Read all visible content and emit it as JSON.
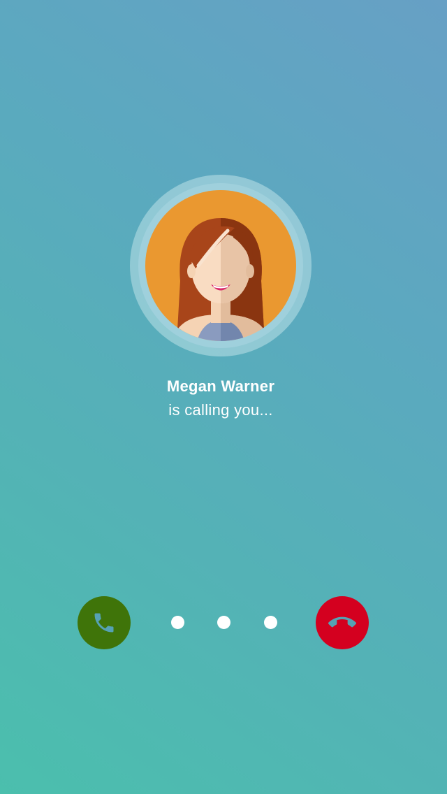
{
  "caller": {
    "name": "Megan Warner",
    "status": "is calling you..."
  },
  "actions": {
    "accept": {
      "icon": "phone-icon",
      "color": "#3f7409"
    },
    "decline": {
      "icon": "phone-hangup-icon",
      "color": "#d4001f"
    }
  },
  "colors": {
    "avatar_background": "#ea9830",
    "background_top": "#67a0c5",
    "background_bottom": "#4bbfad",
    "icon_color": "#56a2b4"
  }
}
